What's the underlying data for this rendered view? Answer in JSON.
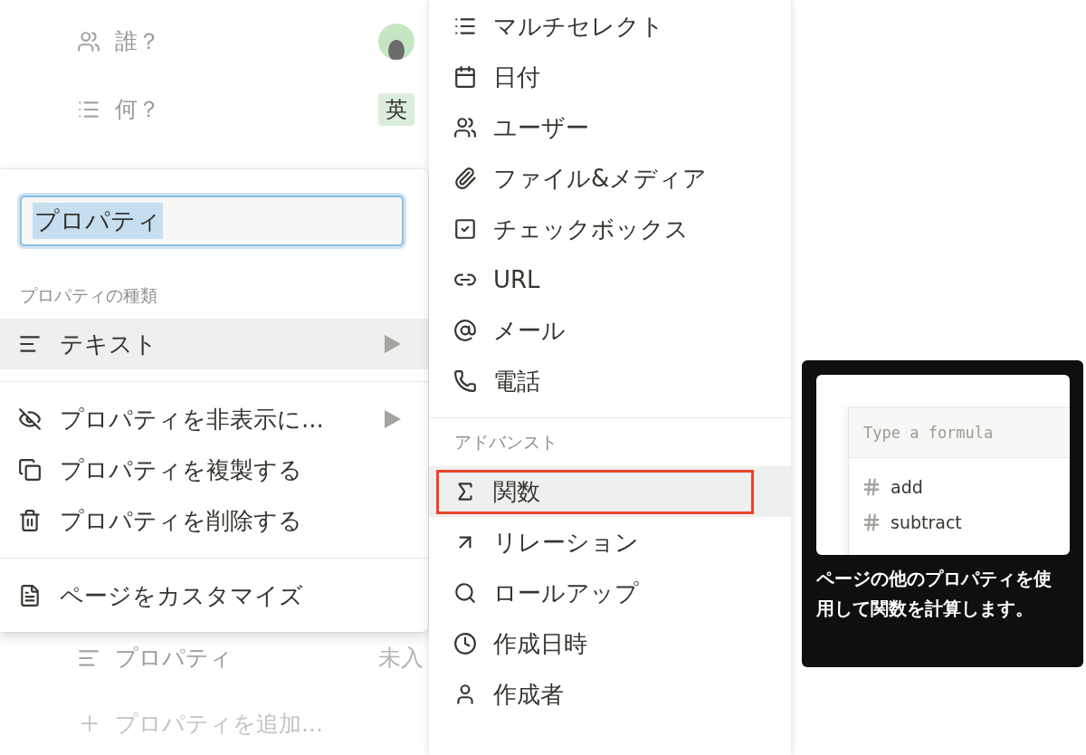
{
  "page": {
    "properties": [
      {
        "kind": "person",
        "label": "誰？"
      },
      {
        "kind": "multi_select",
        "label": "何？",
        "value": "英"
      },
      {
        "kind": "text",
        "label": "プロパティ",
        "value": "未入"
      }
    ],
    "add_property": "プロパティを追加..."
  },
  "property_menu": {
    "name_input": {
      "value": "プロパティ"
    },
    "type_section": "プロパティの種類",
    "type_item": {
      "kind": "text",
      "label": "テキスト",
      "highlighted": true,
      "submenu": true
    },
    "actions": [
      {
        "kind": "hide",
        "label": "プロパティを非表示に...",
        "submenu": true
      },
      {
        "kind": "duplicate",
        "label": "プロパティを複製する",
        "submenu": false
      },
      {
        "kind": "delete",
        "label": "プロパティを削除する",
        "submenu": false
      }
    ],
    "customize": {
      "kind": "customize",
      "label": "ページをカスタマイズ"
    }
  },
  "type_menu": {
    "basic": [
      {
        "kind": "multi_select",
        "label": "マルチセレクト",
        "selected": false
      },
      {
        "kind": "date",
        "label": "日付",
        "selected": false
      },
      {
        "kind": "person",
        "label": "ユーザー",
        "selected": false
      },
      {
        "kind": "files",
        "label": "ファイル&メディア",
        "selected": false
      },
      {
        "kind": "checkbox",
        "label": "チェックボックス",
        "selected": false
      },
      {
        "kind": "url",
        "label": "URL",
        "selected": false
      },
      {
        "kind": "email",
        "label": "メール",
        "selected": false
      },
      {
        "kind": "phone",
        "label": "電話",
        "selected": false
      }
    ],
    "advanced_section": "アドバンスト",
    "advanced": [
      {
        "kind": "formula",
        "label": "関数",
        "selected": true
      },
      {
        "kind": "relation",
        "label": "リレーション",
        "selected": false
      },
      {
        "kind": "rollup",
        "label": "ロールアップ",
        "selected": false
      },
      {
        "kind": "created_time",
        "label": "作成日時",
        "selected": false
      },
      {
        "kind": "created_by",
        "label": "作成者",
        "selected": false
      }
    ]
  },
  "tooltip": {
    "preview": {
      "placeholder": "Type a formula",
      "functions": [
        "add",
        "subtract"
      ]
    },
    "description": "ページの他のプロパティを使用して関数を計算します。"
  }
}
